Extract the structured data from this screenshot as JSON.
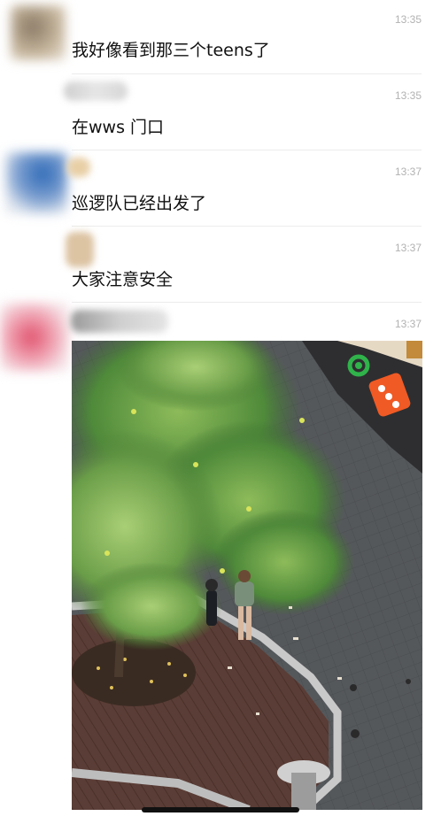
{
  "messages": [
    {
      "time": "13:35",
      "text": "我好像看到那三个teens了"
    },
    {
      "time": "13:35",
      "text": "在wws 门口"
    },
    {
      "time": "13:37",
      "text": "巡逻队已经出发了"
    },
    {
      "time": "13:37",
      "text": "大家注意安全"
    },
    {
      "time": "13:37",
      "image": "street-photo"
    }
  ],
  "colors": {
    "background": "#ffffff",
    "time_text": "#b2b2b2",
    "message_text": "#111111",
    "divider": "#ececec",
    "store_sign_green": "#2fb34a",
    "store_sign_orange": "#f05a24"
  }
}
